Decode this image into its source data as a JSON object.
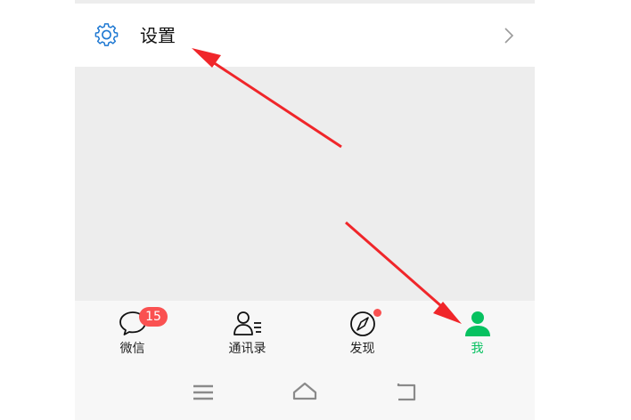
{
  "settings": {
    "label": "设置",
    "icon": "gear-icon",
    "chevron": "chevron-right-icon"
  },
  "tabs": [
    {
      "label": "微信",
      "icon": "chat-bubble-icon",
      "badge": "15"
    },
    {
      "label": "通讯录",
      "icon": "contacts-icon"
    },
    {
      "label": "发现",
      "icon": "compass-icon",
      "dot": true
    },
    {
      "label": "我",
      "icon": "person-icon",
      "active": true
    }
  ],
  "navbar": {
    "buttons": [
      "menu-icon",
      "home-icon",
      "back-icon"
    ]
  },
  "colors": {
    "accent": "#07c160",
    "badge": "#fa5151",
    "arrow": "#f0262a",
    "icon_blue": "#1e78d2"
  }
}
